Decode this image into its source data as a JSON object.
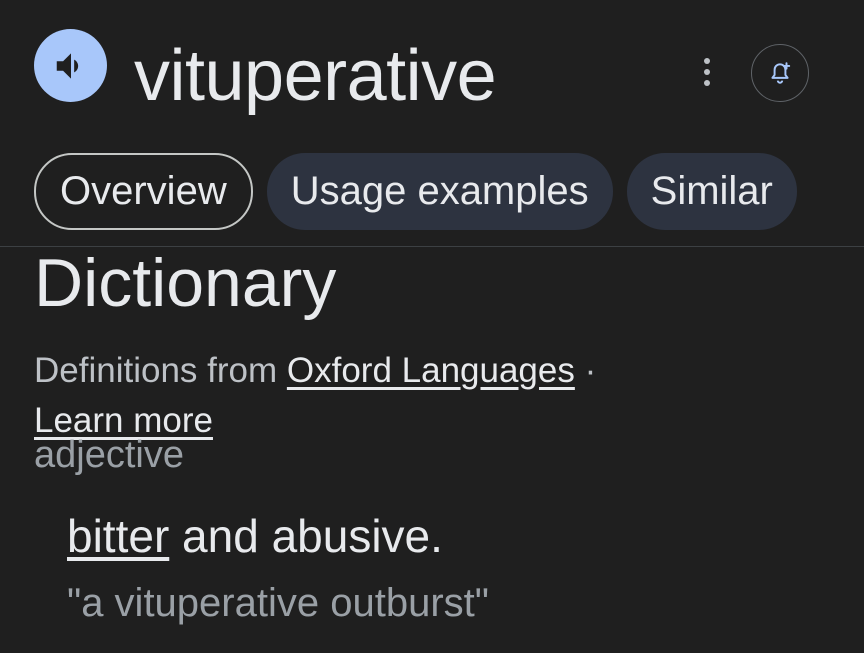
{
  "header": {
    "headword": "vituperative",
    "speaker_icon": "volume-up-icon",
    "more_icon": "more-vertical-icon",
    "alert_icon": "add-alert-icon",
    "speaker_bg": "#a8c7fa"
  },
  "tabs": [
    {
      "label": "Overview",
      "active": true
    },
    {
      "label": "Usage examples",
      "active": false
    },
    {
      "label": "Similar",
      "active": false
    }
  ],
  "dictionary": {
    "title": "Dictionary",
    "source_prefix": "Definitions from",
    "source_link": "Oxford Languages",
    "separator": " ·",
    "learn_more": "Learn more",
    "part_of_speech": "adjective",
    "definition_link": "bitter",
    "definition_rest": " and abusive.",
    "example": "\"a vituperative outburst\""
  }
}
